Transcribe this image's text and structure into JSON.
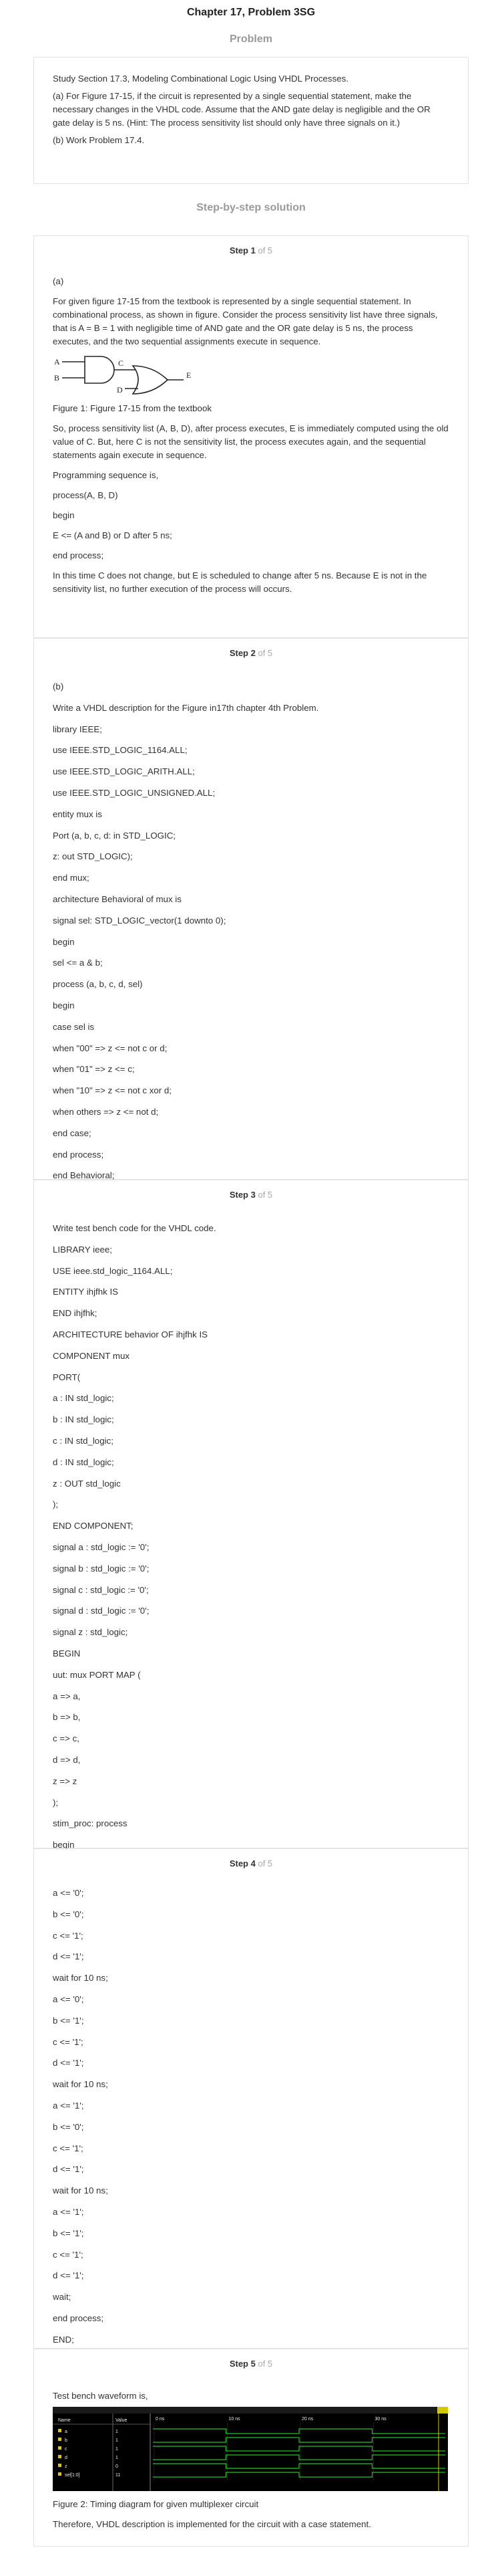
{
  "header": {
    "title": "Chapter 17, Problem 3SG"
  },
  "problem": {
    "heading": "Problem",
    "paragraphs": [
      "Study Section 17.3, Modeling Combinational Logic Using VHDL Processes.",
      "(a) For Figure 17-15, if the circuit is represented by a single sequential statement, make the necessary changes in the VHDL code. Assume that the AND gate delay is negligible and the OR gate delay is 5 ns. (Hint: The process sensitivity list should only have three signals on it.)",
      "(b) Work Problem 17.4."
    ]
  },
  "solution": {
    "heading": "Step-by-step solution"
  },
  "steps": [
    {
      "label": "Step 1",
      "of": "of 5",
      "intro_lines": [
        "(a)",
        "For given figure 17-15 from the textbook is represented by a single sequential statement. In combinational process, as shown in figure. Consider the process sensitivity list have three signals, that is A = B = 1 with negligible time of AND gate and the OR gate delay is 5 ns, the process executes, and the two sequential assignments execute in sequence."
      ],
      "figure": {
        "labels": {
          "a": "A",
          "b": "B",
          "c": "C",
          "d": "D",
          "e": "E"
        },
        "caption": "Figure 1: Figure 17-15 from the textbook"
      },
      "lines": [
        "So, process sensitivity list (A, B, D), after process executes, E is immediately computed using the old value of C. But, here C is not the sensitivity list, the process executes again, and the sequential statements again execute in sequence.",
        "Programming sequence is,",
        "process(A, B, D)",
        "begin",
        "E <= (A and B) or D after 5 ns;",
        "end process;",
        "In this time C does not change, but E is scheduled to change after 5 ns. Because E is not in the sensitivity list, no further execution of the process will occurs."
      ]
    },
    {
      "label": "Step 2",
      "of": "of 5",
      "lines": [
        "(b)",
        "Write a VHDL description for the Figure in17th chapter 4th Problem.",
        "library IEEE;",
        "use IEEE.STD_LOGIC_1164.ALL;",
        "use IEEE.STD_LOGIC_ARITH.ALL;",
        "use IEEE.STD_LOGIC_UNSIGNED.ALL;",
        "entity mux is",
        "Port (a, b, c, d: in STD_LOGIC;",
        "z: out STD_LOGIC);",
        "end mux;",
        "architecture Behavioral of mux is",
        "signal sel: STD_LOGIC_vector(1 downto 0);",
        "begin",
        "sel <= a & b;",
        "process (a, b, c, d, sel)",
        "begin",
        "case sel is",
        "when \"00\" => z <= not c or d;",
        "when \"01\" => z <= c;",
        "when \"10\" => z <= not c xor d;",
        "when others => z <= not d;",
        "end case;",
        "end process;",
        "end Behavioral;"
      ]
    },
    {
      "label": "Step 3",
      "of": "of 5",
      "lines": [
        "Write test bench code for the VHDL code.",
        "LIBRARY ieee;",
        "USE ieee.std_logic_1164.ALL;",
        "ENTITY ihjfhk IS",
        "END ihjfhk;",
        "ARCHITECTURE behavior OF ihjfhk IS",
        "COMPONENT mux",
        "PORT(",
        "a : IN std_logic;",
        "b : IN std_logic;",
        "c : IN std_logic;",
        "d : IN std_logic;",
        "z : OUT std_logic",
        ");",
        "END COMPONENT;",
        "signal a : std_logic := '0';",
        "signal b : std_logic := '0';",
        "signal c : std_logic := '0';",
        "signal d : std_logic := '0';",
        "signal z : std_logic;",
        "BEGIN",
        "uut: mux PORT MAP (",
        "a => a,",
        "b => b,",
        "c => c,",
        "d => d,",
        "z => z",
        ");",
        "stim_proc: process",
        "begin"
      ]
    },
    {
      "label": "Step 4",
      "of": "of 5",
      "lines": [
        "a <= '0';",
        "b <= '0';",
        "c <= '1';",
        "d <= '1';",
        "wait for 10 ns;",
        "a <= '0';",
        "b <= '1';",
        "c <= '1';",
        "d <= '1';",
        "wait for 10 ns;",
        "a <= '1';",
        "b <= '0';",
        "c <= '1';",
        "d <= '1';",
        "wait for 10 ns;",
        "a <= '1';",
        "b <= '1';",
        "c <= '1';",
        "d <= '1';",
        "wait;",
        "end process;",
        "END;"
      ]
    },
    {
      "label": "Step 5",
      "of": "of 5",
      "intro": "Test bench waveform is,",
      "waveform": {
        "name_header": "Name",
        "value_header": "Value",
        "signals": [
          {
            "name": "a",
            "value": "1"
          },
          {
            "name": "b",
            "value": "1"
          },
          {
            "name": "c",
            "value": "1"
          },
          {
            "name": "d",
            "value": "1"
          },
          {
            "name": "z",
            "value": "0"
          },
          {
            "name": "sel[1:0]",
            "value": "11"
          }
        ],
        "time_markers": [
          "0 ns",
          "10 ns",
          "20 ns",
          "30 ns"
        ]
      },
      "caption": "Figure 2: Timing diagram for given multiplexer circuit",
      "conclusion": "Therefore, VHDL description is implemented for the circuit with a case statement."
    }
  ]
}
